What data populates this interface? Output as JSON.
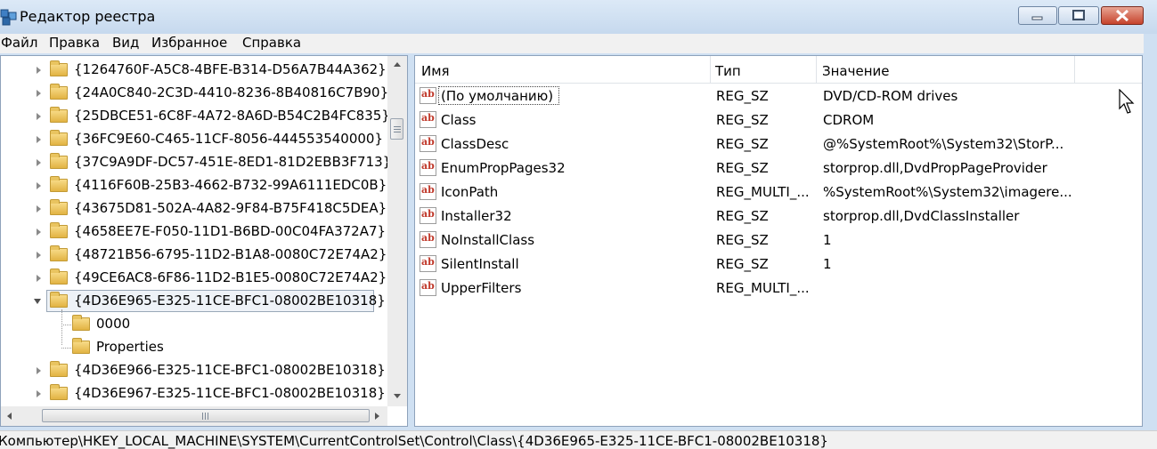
{
  "window": {
    "title": "Редактор реестра",
    "minimize_glyph": "▁",
    "maximize_glyph": "▢",
    "close_glyph": "✕"
  },
  "menu": [
    "Файл",
    "Правка",
    "Вид",
    "Избранное",
    "Справка"
  ],
  "tree": {
    "items": [
      {
        "label": "{1264760F-A5C8-4BFE-B314-D56A7B44A362}",
        "level": 0,
        "state": "collapsed"
      },
      {
        "label": "{24A0C840-2C3D-4410-8236-8B40816C7B90}",
        "level": 0,
        "state": "collapsed"
      },
      {
        "label": "{25DBCE51-6C8F-4A72-8A6D-B54C2B4FC835}",
        "level": 0,
        "state": "collapsed"
      },
      {
        "label": "{36FC9E60-C465-11CF-8056-444553540000}",
        "level": 0,
        "state": "collapsed"
      },
      {
        "label": "{37C9A9DF-DC57-451E-8ED1-81D2EBB3F713}",
        "level": 0,
        "state": "collapsed"
      },
      {
        "label": "{4116F60B-25B3-4662-B732-99A6111EDC0B}",
        "level": 0,
        "state": "collapsed"
      },
      {
        "label": "{43675D81-502A-4A82-9F84-B75F418C5DEA}",
        "level": 0,
        "state": "collapsed"
      },
      {
        "label": "{4658EE7E-F050-11D1-B6BD-00C04FA372A7}",
        "level": 0,
        "state": "collapsed"
      },
      {
        "label": "{48721B56-6795-11D2-B1A8-0080C72E74A2}",
        "level": 0,
        "state": "collapsed"
      },
      {
        "label": "{49CE6AC8-6F86-11D2-B1E5-0080C72E74A2}",
        "level": 0,
        "state": "collapsed"
      },
      {
        "label": "{4D36E965-E325-11CE-BFC1-08002BE10318}",
        "level": 0,
        "state": "expanded",
        "selected": true
      },
      {
        "label": "0000",
        "level": 1,
        "state": "leaf"
      },
      {
        "label": "Properties",
        "level": 1,
        "state": "leaf"
      },
      {
        "label": "{4D36E966-E325-11CE-BFC1-08002BE10318}",
        "level": 0,
        "state": "collapsed"
      },
      {
        "label": "{4D36E967-E325-11CE-BFC1-08002BE10318}",
        "level": 0,
        "state": "collapsed"
      }
    ]
  },
  "list": {
    "columns": [
      "Имя",
      "Тип",
      "Значение"
    ],
    "icon_text": "ab",
    "rows": [
      {
        "name": "(По умолчанию)",
        "type": "REG_SZ",
        "value": "DVD/CD-ROM drives"
      },
      {
        "name": "Class",
        "type": "REG_SZ",
        "value": "CDROM"
      },
      {
        "name": "ClassDesc",
        "type": "REG_SZ",
        "value": "@%SystemRoot%\\System32\\StorP..."
      },
      {
        "name": "EnumPropPages32",
        "type": "REG_SZ",
        "value": "storprop.dll,DvdPropPageProvider"
      },
      {
        "name": "IconPath",
        "type": "REG_MULTI_...",
        "value": "%SystemRoot%\\System32\\imagere..."
      },
      {
        "name": "Installer32",
        "type": "REG_SZ",
        "value": "storprop.dll,DvdClassInstaller"
      },
      {
        "name": "NoInstallClass",
        "type": "REG_SZ",
        "value": "1"
      },
      {
        "name": "SilentInstall",
        "type": "REG_SZ",
        "value": "1"
      },
      {
        "name": "UpperFilters",
        "type": "REG_MULTI_...",
        "value": ""
      }
    ]
  },
  "status": "Компьютер\\HKEY_LOCAL_MACHINE\\SYSTEM\\CurrentControlSet\\Control\\Class\\{4D36E965-E325-11CE-BFC1-08002BE10318}"
}
